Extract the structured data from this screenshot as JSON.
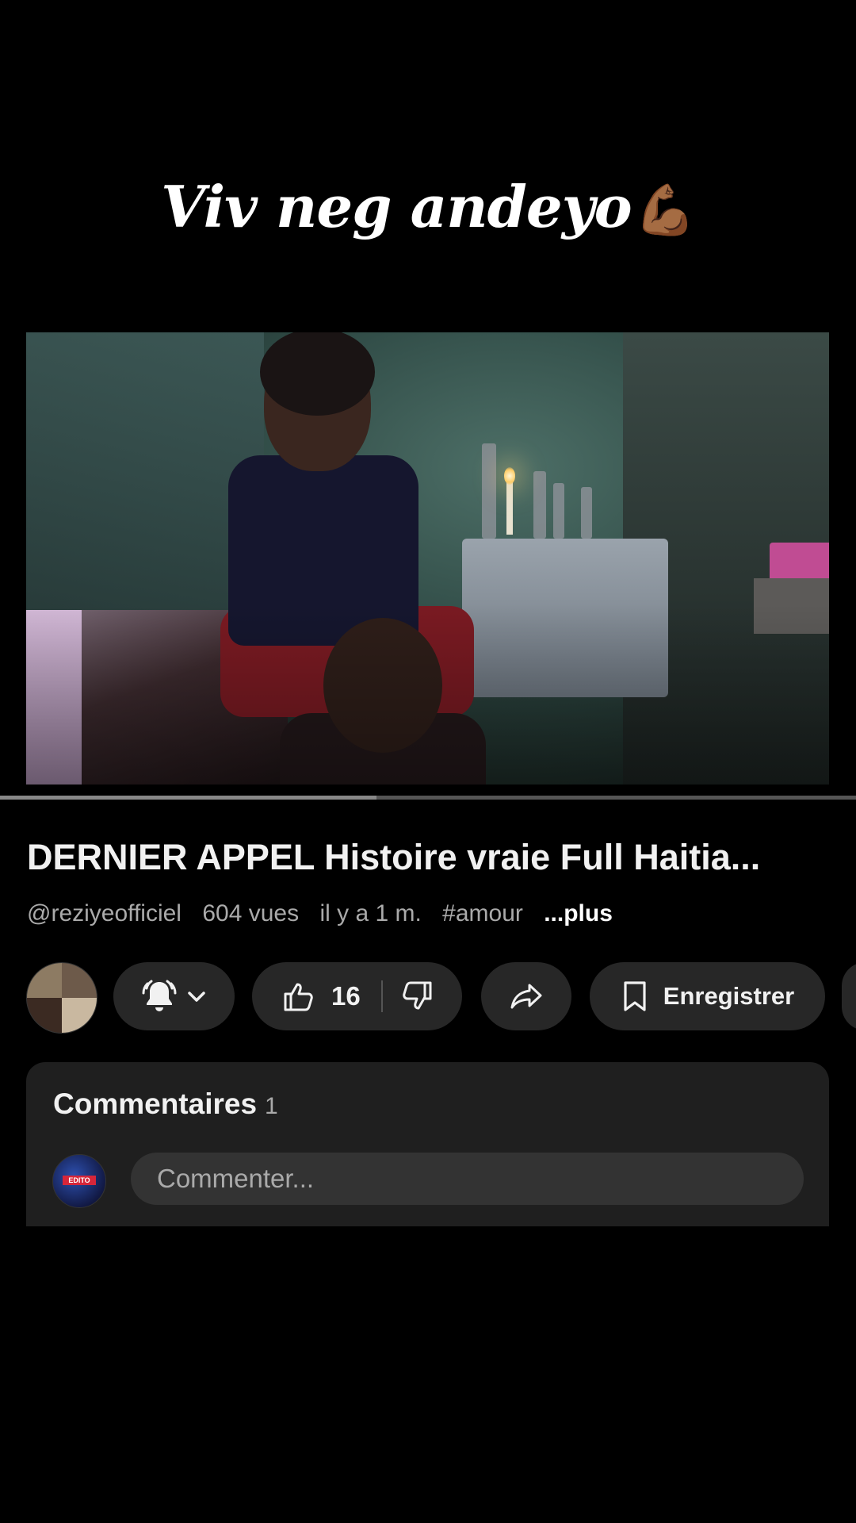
{
  "overlay": {
    "title": "Viv neg andeyo",
    "emoji": "💪🏾"
  },
  "video": {
    "progress_percent": 39.5,
    "buffer_percent": 44
  },
  "info": {
    "title": "DERNIER APPEL Histoire vraie Full Haitia...",
    "channel": "@reziyeofficiel",
    "views": "604 vues",
    "time": "il y a 1 m.",
    "hashtag": "#amour",
    "more": "...plus"
  },
  "actions": {
    "like_count": "16",
    "save_label": "Enregistrer"
  },
  "comments": {
    "title": "Commentaires",
    "count": "1",
    "placeholder": "Commenter...",
    "avatar_tag": "EDITO"
  },
  "icons": {
    "bell": "bell-ringing-icon",
    "chevron": "chevron-down-icon",
    "like": "thumbs-up-icon",
    "dislike": "thumbs-down-icon",
    "share": "share-arrow-icon",
    "save": "bookmark-icon"
  }
}
